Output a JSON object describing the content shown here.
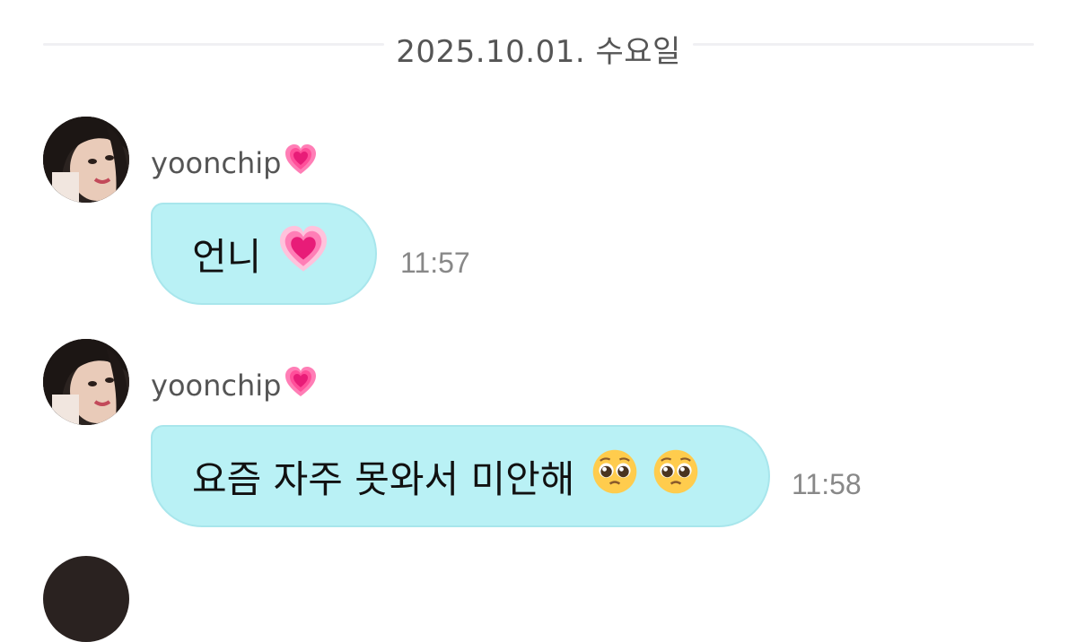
{
  "date_divider": {
    "text": "2025.10.01. 수요일"
  },
  "messages": [
    {
      "sender": "yoonchip",
      "sender_heart_icon": "growing-heart-emoji",
      "text": "언니",
      "emojis": [
        "growing-heart-emoji"
      ],
      "time": "11:57"
    },
    {
      "sender": "yoonchip",
      "sender_heart_icon": "growing-heart-emoji",
      "text": "요즘 자주 못와서 미안해",
      "emojis": [
        "pleading-face-emoji",
        "pleading-face-emoji"
      ],
      "time": "11:58"
    }
  ],
  "colors": {
    "bubble_bg": "#b9f1f5",
    "bubble_border": "#a8e6ec",
    "meta_text": "#888888",
    "sender_text": "#555555"
  }
}
